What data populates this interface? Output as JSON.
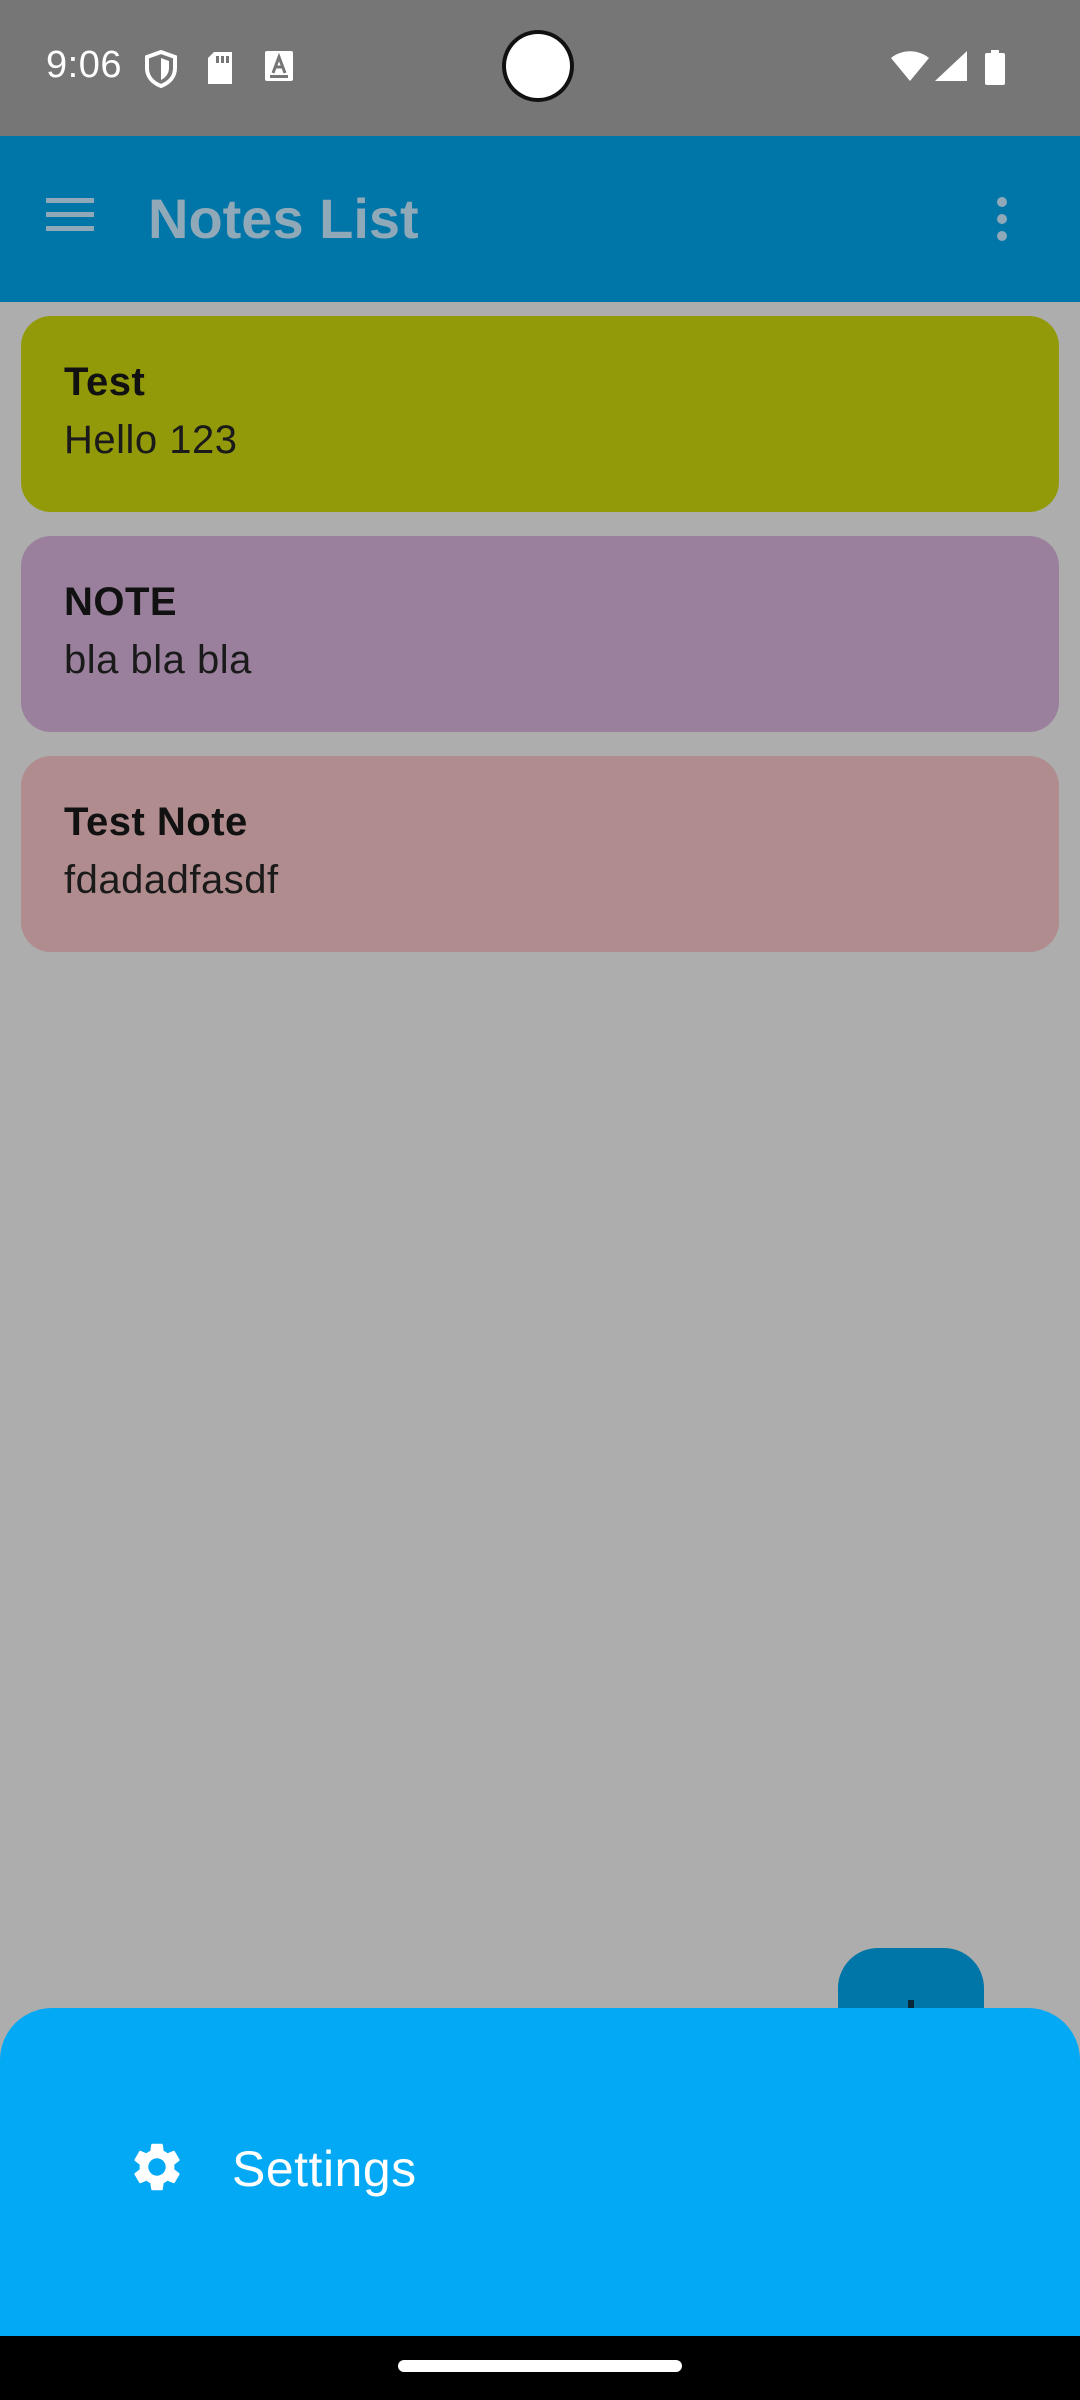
{
  "status_bar": {
    "time": "9:06",
    "left_icons": [
      "shield-icon",
      "sd-card-icon",
      "font-a-icon"
    ],
    "right_icons": [
      "wifi-icon",
      "signal-icon",
      "battery-icon"
    ]
  },
  "app_bar": {
    "title": "Notes List",
    "background": "#0075a8",
    "title_color": "#8fa9b8"
  },
  "notes": [
    {
      "title": "Test",
      "body": "Hello 123",
      "color": "#939a0a"
    },
    {
      "title": "NOTE",
      "body": "bla bla bla",
      "color": "#9a809c"
    },
    {
      "title": "Test Note",
      "body": "fdadadfasdf",
      "color": "#b08c8e"
    }
  ],
  "fab": {
    "icon": "plus-icon",
    "color": "#0075a8"
  },
  "bottom_sheet": {
    "background": "#03a9f4",
    "items": [
      {
        "label": "Settings",
        "icon": "gear-icon"
      }
    ]
  }
}
